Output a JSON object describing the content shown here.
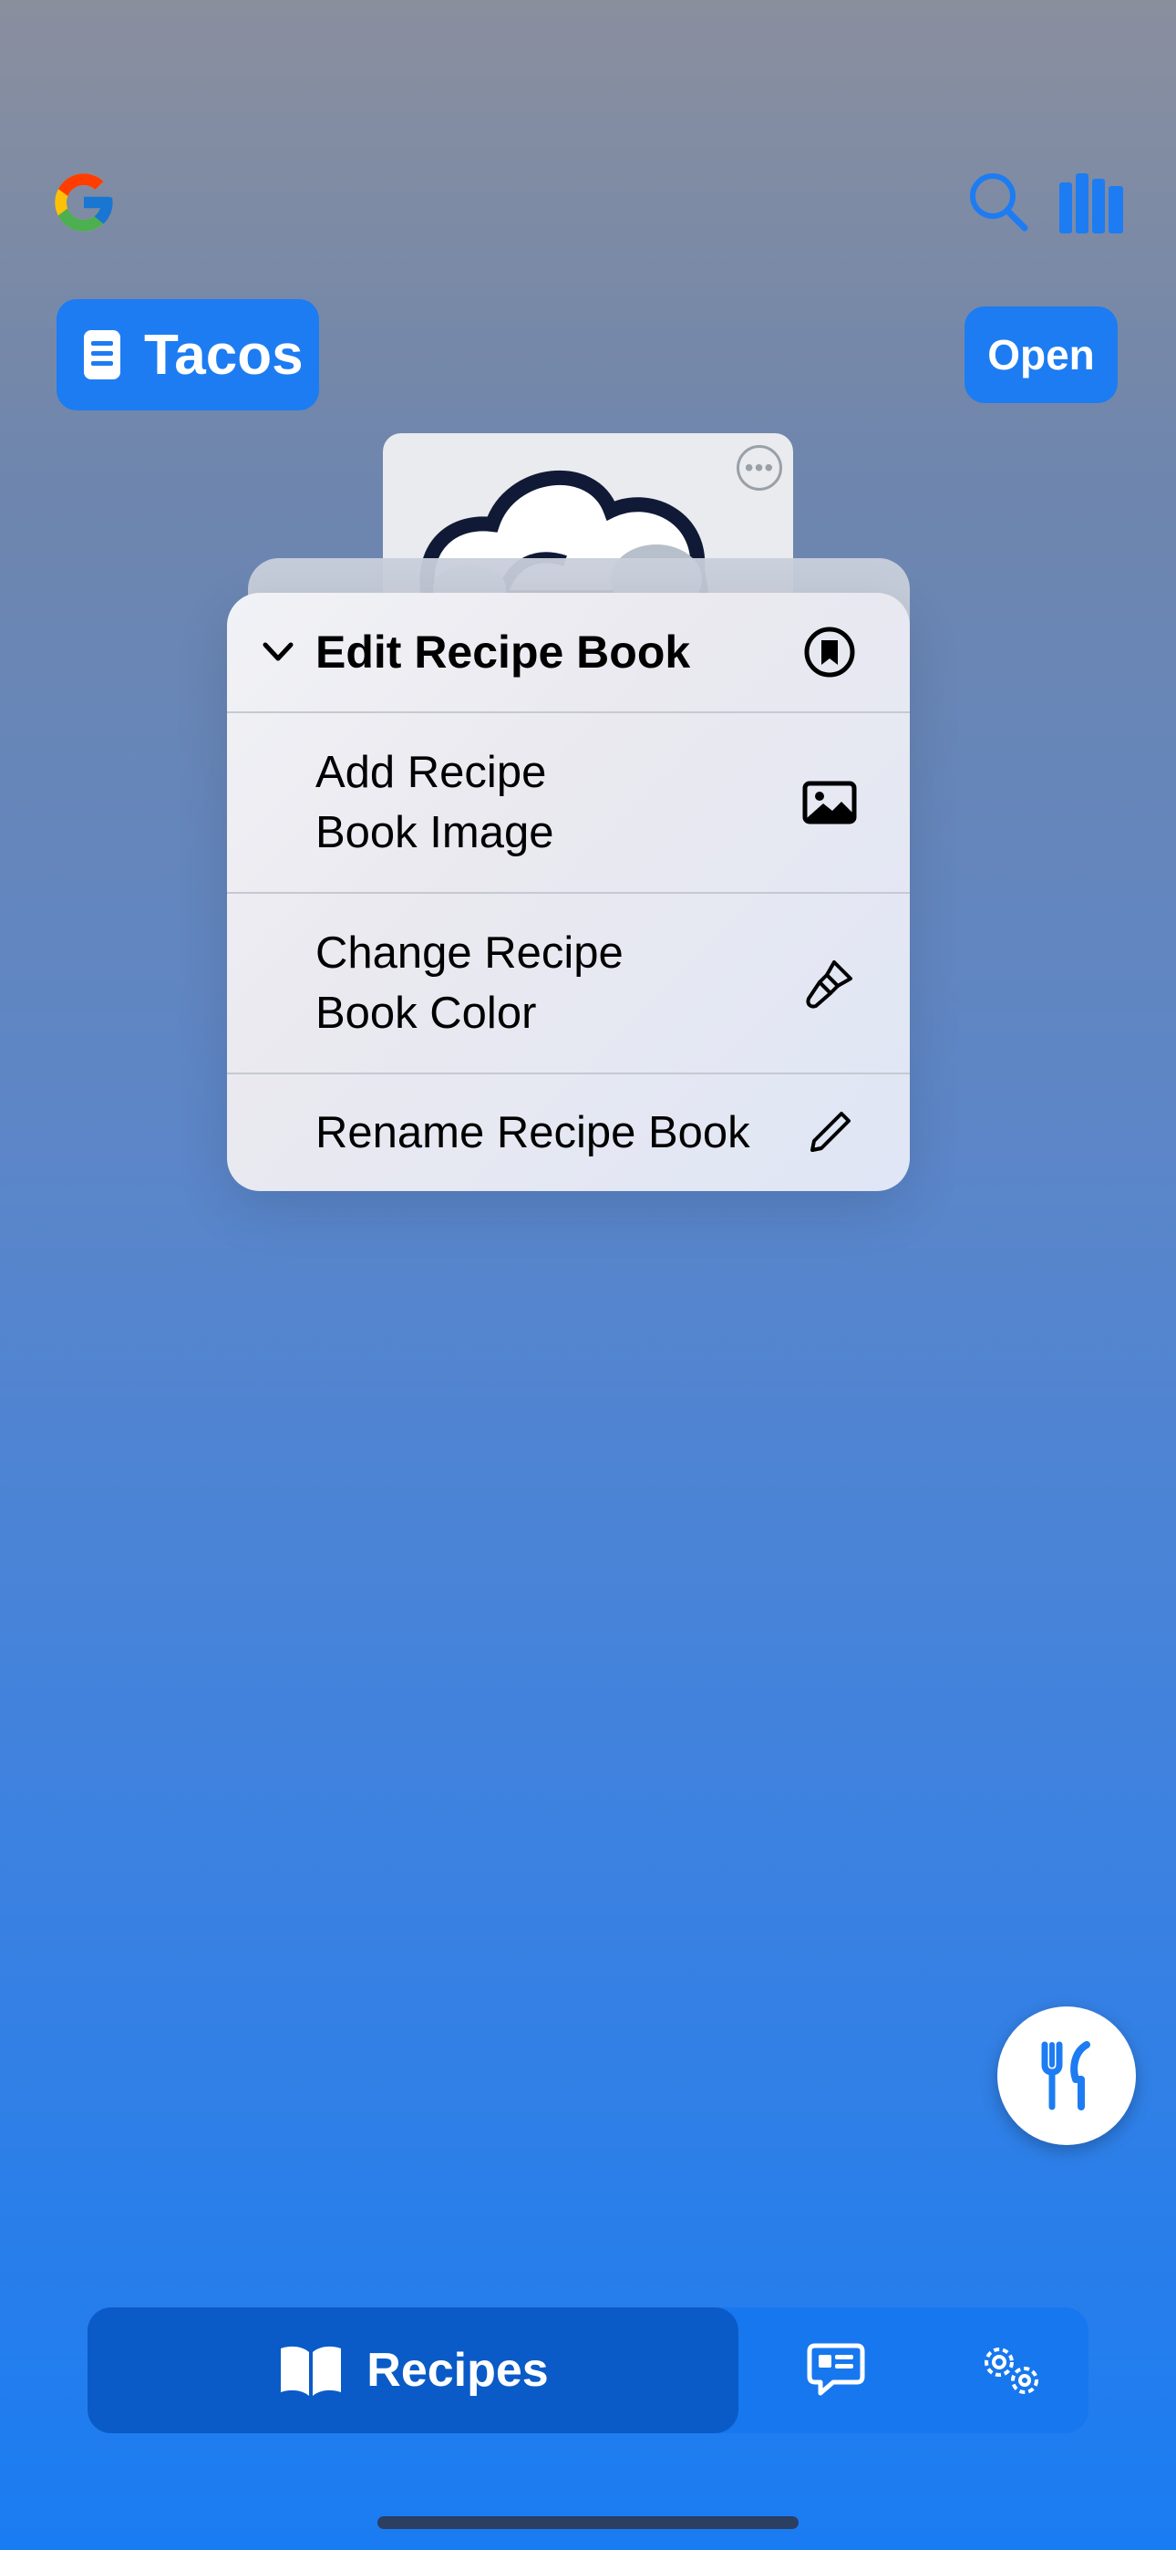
{
  "header": {
    "logo_icon": "google-logo-icon",
    "search_icon": "search-icon",
    "library_icon": "library-books-icon",
    "accent_color": "#1d7cf2"
  },
  "book": {
    "title": "Tacos",
    "open_label": "Open"
  },
  "card": {
    "more_label": "•••"
  },
  "context_menu": {
    "header": {
      "label": "Edit Recipe Book",
      "icon": "bookmark-circle-icon"
    },
    "items": [
      {
        "label_line1": "Add Recipe",
        "label_line2": "Book Image",
        "icon": "photo-icon"
      },
      {
        "label_line1": "Change Recipe",
        "label_line2": "Book Color",
        "icon": "paintbrush-icon"
      },
      {
        "label_line1": "Rename Recipe Book",
        "label_line2": "",
        "icon": "pencil-icon"
      }
    ]
  },
  "fab": {
    "icon": "fork-knife-icon"
  },
  "tabbar": {
    "tabs": [
      {
        "label": "Recipes",
        "icon": "book-icon",
        "selected": true
      },
      {
        "label": "",
        "icon": "chat-bubble-icon",
        "selected": false
      },
      {
        "label": "",
        "icon": "gears-icon",
        "selected": false
      }
    ]
  }
}
